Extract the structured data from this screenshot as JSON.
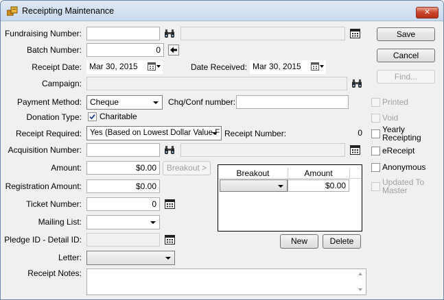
{
  "window": {
    "title": "Receipting Maintenance",
    "close_label": "✕"
  },
  "labels": {
    "fundraising_number": "Fundraising Number:",
    "batch_number": "Batch Number:",
    "receipt_date": "Receipt Date:",
    "date_received": "Date Received:",
    "campaign": "Campaign:",
    "payment_method": "Payment Method:",
    "chq_conf_number": "Chq/Conf number:",
    "donation_type": "Donation Type:",
    "receipt_required": "Receipt Required:",
    "receipt_number": "Receipt Number:",
    "acquisition_number": "Acquisition Number:",
    "amount": "Amount:",
    "registration_amount": "Registration Amount:",
    "ticket_number": "Ticket Number:",
    "mailing_list": "Mailing List:",
    "pledge_id": "Pledge ID - Detail ID:",
    "letter": "Letter:",
    "receipt_notes": "Receipt Notes:"
  },
  "values": {
    "fundraising_number": "",
    "fundraising_desc": "",
    "batch_number": "0",
    "receipt_date": "Mar 30, 2015",
    "date_received": "Mar 30, 2015",
    "campaign": "",
    "payment_method": "Cheque",
    "chq_conf_number": "",
    "donation_type_checkbox_label": "Charitable",
    "receipt_required": "Yes (Based on Lowest Dollar Value F",
    "receipt_number": "0",
    "acquisition_number": "",
    "acquisition_desc": "",
    "amount": "$0.00",
    "registration_amount": "$0.00",
    "ticket_number": "0",
    "mailing_list": "",
    "pledge_id": "",
    "letter": "",
    "receipt_notes": ""
  },
  "buttons": {
    "save": "Save",
    "cancel": "Cancel",
    "find": "Find...",
    "breakout": "Breakout >",
    "new": "New",
    "delete": "Delete"
  },
  "breakout_grid": {
    "columns": [
      "Breakout",
      "Amount"
    ],
    "rows": [
      {
        "breakout": "",
        "amount": "$0.00"
      }
    ]
  },
  "side_checkboxes": [
    {
      "label": "Printed",
      "checked": false,
      "enabled": false
    },
    {
      "label": "Void",
      "checked": false,
      "enabled": false
    },
    {
      "label": "Yearly\nReceipting",
      "checked": false,
      "enabled": true
    },
    {
      "label": "eReceipt",
      "checked": false,
      "enabled": true
    },
    {
      "label": "Anonymous",
      "checked": false,
      "enabled": true
    },
    {
      "label": "Updated To\nMaster",
      "checked": false,
      "enabled": false
    }
  ],
  "icons": {
    "binoculars": "binoculars-icon",
    "calendar": "calendar-icon",
    "arrow_left": "arrow-left-icon",
    "date_picker": "date-picker-icon"
  }
}
